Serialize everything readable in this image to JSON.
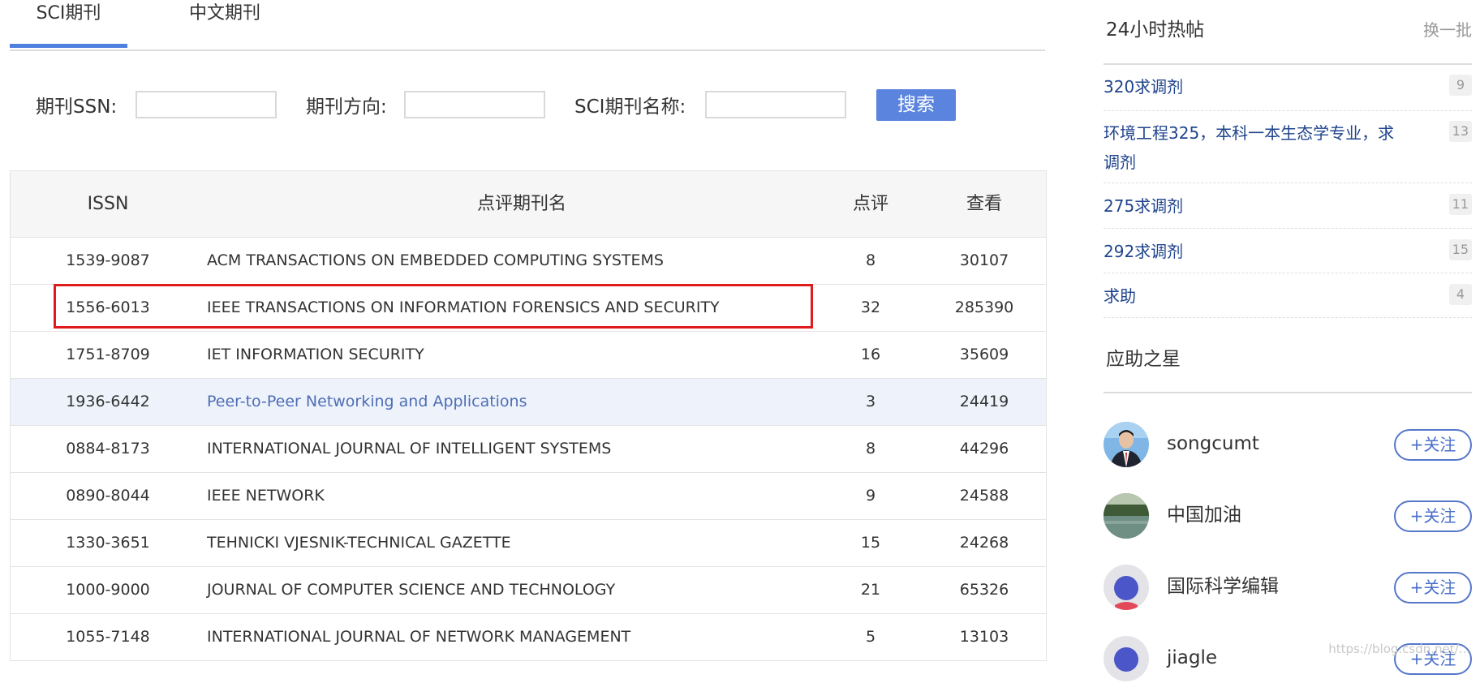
{
  "tabs": [
    {
      "label": "SCI期刊",
      "active": true
    },
    {
      "label": "中文期刊",
      "active": false
    }
  ],
  "search": {
    "issn_label": "期刊SSN:",
    "direction_label": "期刊方向:",
    "name_label": "SCI期刊名称:",
    "issn_value": "",
    "direction_value": "",
    "name_value": "",
    "button_label": "搜索"
  },
  "table": {
    "headers": {
      "issn": "ISSN",
      "name": "点评期刊名",
      "reviews": "点评",
      "views": "查看"
    },
    "rows": [
      {
        "issn": "1539-9087",
        "name": "ACM TRANSACTIONS ON EMBEDDED COMPUTING SYSTEMS",
        "reviews": "8",
        "views": "30107"
      },
      {
        "issn": "1556-6013",
        "name": "IEEE TRANSACTIONS ON INFORMATION FORENSICS AND SECURITY",
        "reviews": "32",
        "views": "285390"
      },
      {
        "issn": "1751-8709",
        "name": "IET INFORMATION SECURITY",
        "reviews": "16",
        "views": "35609"
      },
      {
        "issn": "1936-6442",
        "name": "Peer-to-Peer Networking and Applications",
        "reviews": "3",
        "views": "24419"
      },
      {
        "issn": "0884-8173",
        "name": "INTERNATIONAL JOURNAL OF INTELLIGENT SYSTEMS",
        "reviews": "8",
        "views": "44296"
      },
      {
        "issn": "0890-8044",
        "name": "IEEE NETWORK",
        "reviews": "9",
        "views": "24588"
      },
      {
        "issn": "1330-3651",
        "name": "TEHNICKI VJESNIK-TECHNICAL GAZETTE",
        "reviews": "15",
        "views": "24268"
      },
      {
        "issn": "1000-9000",
        "name": "JOURNAL OF COMPUTER SCIENCE AND TECHNOLOGY",
        "reviews": "21",
        "views": "65326"
      },
      {
        "issn": "1055-7148",
        "name": "INTERNATIONAL JOURNAL OF NETWORK MANAGEMENT",
        "reviews": "5",
        "views": "13103"
      }
    ]
  },
  "hot": {
    "title": "24小时热帖",
    "switch_label": "换一批",
    "items": [
      {
        "text": "320求调剂",
        "count": "9"
      },
      {
        "text": "环境工程325，本科一本生态学专业，求",
        "text2": "调剂",
        "count": "13"
      },
      {
        "text": "275求调剂",
        "count": "11"
      },
      {
        "text": "292求调剂",
        "count": "15"
      },
      {
        "text": "求助",
        "count": "4"
      }
    ]
  },
  "stars": {
    "title": "应助之星",
    "follow_label": "+关注",
    "users": [
      {
        "name": "songcumt"
      },
      {
        "name": "中国加油"
      },
      {
        "name": "国际科学编辑"
      },
      {
        "name": "jiagle"
      }
    ]
  },
  "watermark": "https://blog.csdn.net/..."
}
